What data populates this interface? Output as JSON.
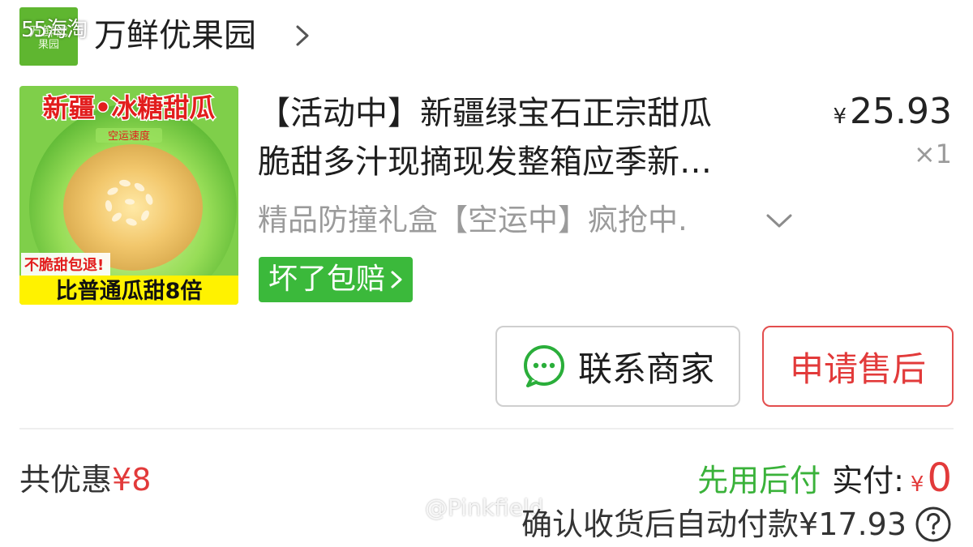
{
  "shop": {
    "logo_line1": "万鲜优",
    "logo_line2": "果园",
    "name": "万鲜优果园"
  },
  "watermark_top": "55海淘",
  "product": {
    "image_banner": "新疆•冰糖甜瓜",
    "image_sub": "空运速度",
    "image_badge": "不脆甜包退!",
    "image_bottom": "比普通瓜甜8倍",
    "title_line1": "【活动中】新疆绿宝石正宗甜瓜",
    "title_line2": "脆甜多汁现摘现发整箱应季新…",
    "price_symbol": "¥",
    "price": "25.93",
    "quantity": "×1",
    "spec": "精品防撞礼盒【空运中】疯抢中."
  },
  "guarantee": {
    "label": "坏了包赔"
  },
  "actions": {
    "contact_label": "联系商家",
    "after_sales_label": "申请售后"
  },
  "summary": {
    "discount_label": "共优惠",
    "discount_amount": "¥8",
    "pay_later": "先用后付",
    "paid_label": "实付:",
    "paid_symbol": "¥",
    "paid_amount": "0",
    "auto_pay_text": "确认收货后自动付款¥17.93"
  },
  "watermark_bottom": "@Pinkfield",
  "icons": {
    "chat": "chat-bubble-icon",
    "help": "question-circle-icon",
    "chevron": "chevron-right-icon",
    "expand": "chevron-down-icon"
  },
  "colors": {
    "green": "#3bb93b",
    "red": "#e23a3a",
    "gray_text": "#9b9b9b"
  }
}
